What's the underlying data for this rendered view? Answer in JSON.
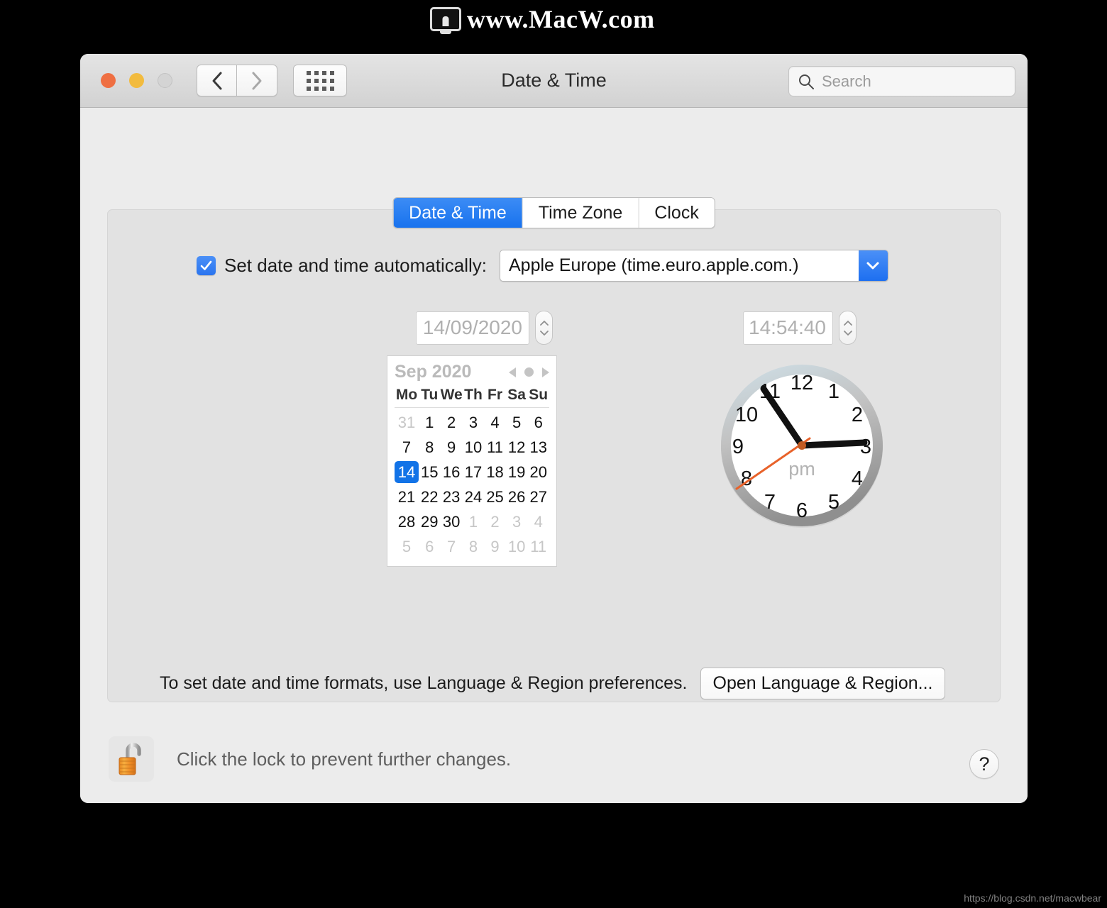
{
  "watermark": {
    "top_text": "www.MacW.com",
    "bottom_text": "https://blog.csdn.net/macwbear",
    "monitor_icon": "monitor-icon"
  },
  "window": {
    "title": "Date & Time",
    "traffic_lights": [
      "close-red",
      "minimize-yellow",
      "zoom-gray"
    ],
    "back_icon": "chevron-left-icon",
    "forward_icon": "chevron-right-icon",
    "grid_icon": "show-all-grid-icon"
  },
  "search": {
    "placeholder": "Search",
    "icon": "search-icon"
  },
  "tabs": [
    {
      "label": "Date & Time",
      "active": true
    },
    {
      "label": "Time Zone",
      "active": false
    },
    {
      "label": "Clock",
      "active": false
    }
  ],
  "auto_row": {
    "checked": true,
    "checkbox_icon": "checkmark-icon",
    "label": "Set date and time automatically:",
    "server_value": "Apple Europe (time.euro.apple.com.)",
    "dropdown_icon": "chevron-down-icon"
  },
  "fields": {
    "date_value": "14/09/2020",
    "time_value": "14:54:40",
    "stepper_up_icon": "chevron-up-icon",
    "stepper_down_icon": "chevron-down-icon"
  },
  "calendar": {
    "title": "Sep 2020",
    "prev_icon": "triangle-left-icon",
    "today_icon": "circle-dot-icon",
    "next_icon": "triangle-right-icon",
    "weekdays": [
      "Mo",
      "Tu",
      "We",
      "Th",
      "Fr",
      "Sa",
      "Su"
    ],
    "selected_day": 14,
    "weeks": [
      [
        {
          "d": "31",
          "m": true
        },
        {
          "d": "1",
          "m": false
        },
        {
          "d": "2",
          "m": false
        },
        {
          "d": "3",
          "m": false
        },
        {
          "d": "4",
          "m": false
        },
        {
          "d": "5",
          "m": false
        },
        {
          "d": "6",
          "m": false
        }
      ],
      [
        {
          "d": "7",
          "m": false
        },
        {
          "d": "8",
          "m": false
        },
        {
          "d": "9",
          "m": false
        },
        {
          "d": "10",
          "m": false
        },
        {
          "d": "11",
          "m": false
        },
        {
          "d": "12",
          "m": false
        },
        {
          "d": "13",
          "m": false
        }
      ],
      [
        {
          "d": "14",
          "m": false,
          "sel": true
        },
        {
          "d": "15",
          "m": false
        },
        {
          "d": "16",
          "m": false
        },
        {
          "d": "17",
          "m": false
        },
        {
          "d": "18",
          "m": false
        },
        {
          "d": "19",
          "m": false
        },
        {
          "d": "20",
          "m": false
        }
      ],
      [
        {
          "d": "21",
          "m": false
        },
        {
          "d": "22",
          "m": false
        },
        {
          "d": "23",
          "m": false
        },
        {
          "d": "24",
          "m": false
        },
        {
          "d": "25",
          "m": false
        },
        {
          "d": "26",
          "m": false
        },
        {
          "d": "27",
          "m": false
        }
      ],
      [
        {
          "d": "28",
          "m": false
        },
        {
          "d": "29",
          "m": false
        },
        {
          "d": "30",
          "m": false
        },
        {
          "d": "1",
          "m": true
        },
        {
          "d": "2",
          "m": true
        },
        {
          "d": "3",
          "m": true
        },
        {
          "d": "4",
          "m": true
        }
      ],
      [
        {
          "d": "5",
          "m": true
        },
        {
          "d": "6",
          "m": true
        },
        {
          "d": "7",
          "m": true
        },
        {
          "d": "8",
          "m": true
        },
        {
          "d": "9",
          "m": true
        },
        {
          "d": "10",
          "m": true
        },
        {
          "d": "11",
          "m": true
        }
      ]
    ]
  },
  "clock": {
    "meridiem": "pm",
    "hour_numbers": [
      "12",
      "1",
      "2",
      "3",
      "4",
      "5",
      "6",
      "7",
      "8",
      "9",
      "10",
      "11"
    ],
    "hour_hand_deg": 87,
    "minute_hand_deg": 328,
    "second_hand_deg": 244,
    "second_hand_color": "#e8622a",
    "face_color": "#ffffff",
    "bezel_color": "#b8b8b8"
  },
  "format_row": {
    "text": "To set date and time formats, use Language & Region preferences.",
    "button_label": "Open Language & Region..."
  },
  "lock_row": {
    "icon": "unlocked-padlock-icon",
    "text": "Click the lock to prevent further changes."
  },
  "help": {
    "label": "?",
    "icon": "help-question-icon"
  }
}
